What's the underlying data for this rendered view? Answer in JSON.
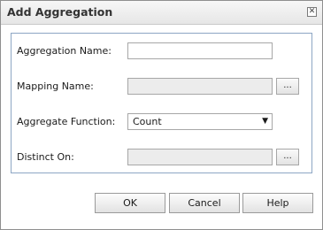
{
  "dialog": {
    "title": "Add Aggregation",
    "close_icon": "close-icon"
  },
  "form": {
    "aggregation_name_label": "Aggregation Name:",
    "aggregation_name_value": "",
    "mapping_name_label": "Mapping Name:",
    "mapping_name_value": "",
    "mapping_browse_label": "...",
    "aggregate_function_label": "Aggregate Function:",
    "aggregate_function_value": "Count",
    "distinct_on_label": "Distinct On:",
    "distinct_on_value": "",
    "distinct_browse_label": "..."
  },
  "buttons": {
    "ok": "OK",
    "cancel": "Cancel",
    "help": "Help"
  }
}
